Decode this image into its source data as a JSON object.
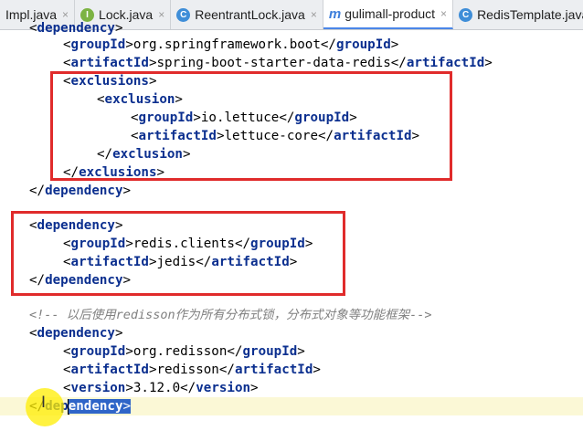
{
  "tabs": [
    {
      "label": "Impl.java",
      "icon": "none",
      "active": false
    },
    {
      "label": "Lock.java",
      "icon": "interface-icon",
      "active": false
    },
    {
      "label": "ReentrantLock.java",
      "icon": "class-icon",
      "active": false
    },
    {
      "label": "gulimall-product",
      "icon": "maven-icon",
      "active": true
    },
    {
      "label": "RedisTemplate.java",
      "icon": "class-icon",
      "active": false
    }
  ],
  "tab_close_glyph": "×",
  "colors": {
    "tag": "#0b2f8f",
    "comment": "#808080",
    "highlight_box": "#e02b2b",
    "selection": "#2f65c8",
    "current_line": "#fbf8d6"
  },
  "code": {
    "l0": {
      "tag": "dependency"
    },
    "l1": {
      "open": "groupId",
      "value": "org.springframework.boot",
      "close": "groupId"
    },
    "l2": {
      "open": "artifactId",
      "value": "spring-boot-starter-data-redis",
      "close": "artifactId"
    },
    "l3": {
      "tag": "exclusions"
    },
    "l4": {
      "tag": "exclusion"
    },
    "l5": {
      "open": "groupId",
      "value": "io.lettuce",
      "close": "groupId"
    },
    "l6": {
      "open": "artifactId",
      "value": "lettuce-core",
      "close": "artifactId"
    },
    "l7": {
      "tag": "exclusion"
    },
    "l8": {
      "tag": "exclusions"
    },
    "l9": {
      "tag": "dependency"
    },
    "l11": {
      "tag": "dependency"
    },
    "l12": {
      "open": "groupId",
      "value": "redis.clients",
      "close": "groupId"
    },
    "l13": {
      "open": "artifactId",
      "value": "jedis",
      "close": "artifactId"
    },
    "l14": {
      "tag": "dependency"
    },
    "l16": {
      "comment": "<!-- 以后使用redisson作为所有分布式锁，分布式对象等功能框架-->"
    },
    "l17": {
      "tag": "dependency"
    },
    "l18": {
      "open": "groupId",
      "value": "org.redisson",
      "close": "groupId"
    },
    "l19": {
      "open": "artifactId",
      "value": "redisson",
      "close": "artifactId"
    },
    "l20": {
      "open": "version",
      "value": "3.12.0",
      "close": "version"
    },
    "l21": {
      "tag_before_caret": "dep",
      "tag_after_caret": "endency"
    }
  }
}
